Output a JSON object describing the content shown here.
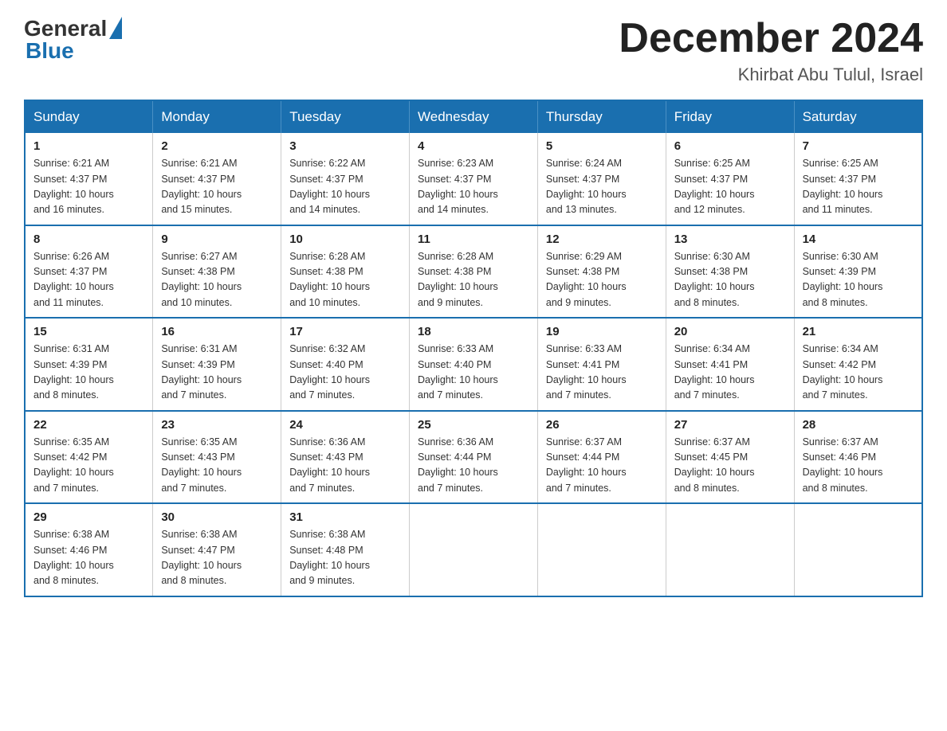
{
  "header": {
    "logo_general": "General",
    "logo_blue": "Blue",
    "month_title": "December 2024",
    "location": "Khirbat Abu Tulul, Israel"
  },
  "days_of_week": [
    "Sunday",
    "Monday",
    "Tuesday",
    "Wednesday",
    "Thursday",
    "Friday",
    "Saturday"
  ],
  "weeks": [
    [
      {
        "day": "1",
        "sunrise": "6:21 AM",
        "sunset": "4:37 PM",
        "daylight": "10 hours and 16 minutes."
      },
      {
        "day": "2",
        "sunrise": "6:21 AM",
        "sunset": "4:37 PM",
        "daylight": "10 hours and 15 minutes."
      },
      {
        "day": "3",
        "sunrise": "6:22 AM",
        "sunset": "4:37 PM",
        "daylight": "10 hours and 14 minutes."
      },
      {
        "day": "4",
        "sunrise": "6:23 AM",
        "sunset": "4:37 PM",
        "daylight": "10 hours and 14 minutes."
      },
      {
        "day": "5",
        "sunrise": "6:24 AM",
        "sunset": "4:37 PM",
        "daylight": "10 hours and 13 minutes."
      },
      {
        "day": "6",
        "sunrise": "6:25 AM",
        "sunset": "4:37 PM",
        "daylight": "10 hours and 12 minutes."
      },
      {
        "day": "7",
        "sunrise": "6:25 AM",
        "sunset": "4:37 PM",
        "daylight": "10 hours and 11 minutes."
      }
    ],
    [
      {
        "day": "8",
        "sunrise": "6:26 AM",
        "sunset": "4:37 PM",
        "daylight": "10 hours and 11 minutes."
      },
      {
        "day": "9",
        "sunrise": "6:27 AM",
        "sunset": "4:38 PM",
        "daylight": "10 hours and 10 minutes."
      },
      {
        "day": "10",
        "sunrise": "6:28 AM",
        "sunset": "4:38 PM",
        "daylight": "10 hours and 10 minutes."
      },
      {
        "day": "11",
        "sunrise": "6:28 AM",
        "sunset": "4:38 PM",
        "daylight": "10 hours and 9 minutes."
      },
      {
        "day": "12",
        "sunrise": "6:29 AM",
        "sunset": "4:38 PM",
        "daylight": "10 hours and 9 minutes."
      },
      {
        "day": "13",
        "sunrise": "6:30 AM",
        "sunset": "4:38 PM",
        "daylight": "10 hours and 8 minutes."
      },
      {
        "day": "14",
        "sunrise": "6:30 AM",
        "sunset": "4:39 PM",
        "daylight": "10 hours and 8 minutes."
      }
    ],
    [
      {
        "day": "15",
        "sunrise": "6:31 AM",
        "sunset": "4:39 PM",
        "daylight": "10 hours and 8 minutes."
      },
      {
        "day": "16",
        "sunrise": "6:31 AM",
        "sunset": "4:39 PM",
        "daylight": "10 hours and 7 minutes."
      },
      {
        "day": "17",
        "sunrise": "6:32 AM",
        "sunset": "4:40 PM",
        "daylight": "10 hours and 7 minutes."
      },
      {
        "day": "18",
        "sunrise": "6:33 AM",
        "sunset": "4:40 PM",
        "daylight": "10 hours and 7 minutes."
      },
      {
        "day": "19",
        "sunrise": "6:33 AM",
        "sunset": "4:41 PM",
        "daylight": "10 hours and 7 minutes."
      },
      {
        "day": "20",
        "sunrise": "6:34 AM",
        "sunset": "4:41 PM",
        "daylight": "10 hours and 7 minutes."
      },
      {
        "day": "21",
        "sunrise": "6:34 AM",
        "sunset": "4:42 PM",
        "daylight": "10 hours and 7 minutes."
      }
    ],
    [
      {
        "day": "22",
        "sunrise": "6:35 AM",
        "sunset": "4:42 PM",
        "daylight": "10 hours and 7 minutes."
      },
      {
        "day": "23",
        "sunrise": "6:35 AM",
        "sunset": "4:43 PM",
        "daylight": "10 hours and 7 minutes."
      },
      {
        "day": "24",
        "sunrise": "6:36 AM",
        "sunset": "4:43 PM",
        "daylight": "10 hours and 7 minutes."
      },
      {
        "day": "25",
        "sunrise": "6:36 AM",
        "sunset": "4:44 PM",
        "daylight": "10 hours and 7 minutes."
      },
      {
        "day": "26",
        "sunrise": "6:37 AM",
        "sunset": "4:44 PM",
        "daylight": "10 hours and 7 minutes."
      },
      {
        "day": "27",
        "sunrise": "6:37 AM",
        "sunset": "4:45 PM",
        "daylight": "10 hours and 8 minutes."
      },
      {
        "day": "28",
        "sunrise": "6:37 AM",
        "sunset": "4:46 PM",
        "daylight": "10 hours and 8 minutes."
      }
    ],
    [
      {
        "day": "29",
        "sunrise": "6:38 AM",
        "sunset": "4:46 PM",
        "daylight": "10 hours and 8 minutes."
      },
      {
        "day": "30",
        "sunrise": "6:38 AM",
        "sunset": "4:47 PM",
        "daylight": "10 hours and 8 minutes."
      },
      {
        "day": "31",
        "sunrise": "6:38 AM",
        "sunset": "4:48 PM",
        "daylight": "10 hours and 9 minutes."
      },
      null,
      null,
      null,
      null
    ]
  ],
  "labels": {
    "sunrise": "Sunrise:",
    "sunset": "Sunset:",
    "daylight": "Daylight:"
  }
}
